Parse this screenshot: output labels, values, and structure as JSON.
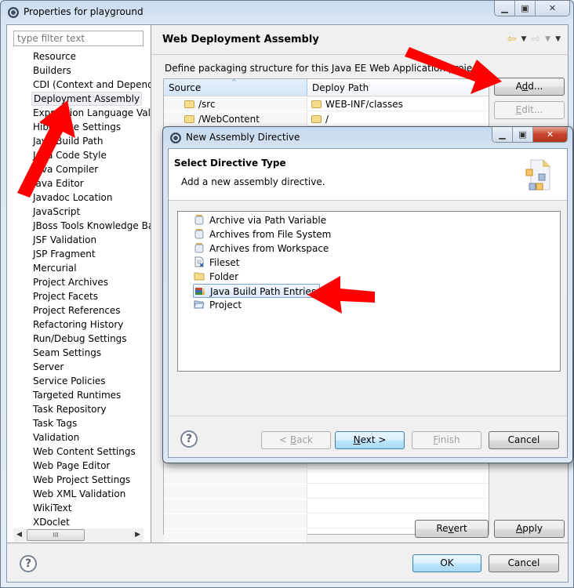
{
  "window": {
    "title": "Properties for playground",
    "icon": "gear-icon",
    "caption_buttons": [
      "minimize",
      "maximize",
      "close"
    ]
  },
  "filter": {
    "placeholder": "type filter text",
    "value": ""
  },
  "tree": {
    "selected": "Deployment Assembly",
    "items": [
      "Resource",
      "Builders",
      "CDI (Context and Dependen",
      "Deployment Assembly",
      "Expression Language Valida",
      "Hibernate Settings",
      "Java Build Path",
      "Java Code Style",
      "Java Compiler",
      "Java Editor",
      "Javadoc Location",
      "JavaScript",
      "JBoss Tools Knowledge Bas",
      "JSF Validation",
      "JSP Fragment",
      "Mercurial",
      "Project Archives",
      "Project Facets",
      "Project References",
      "Refactoring History",
      "Run/Debug Settings",
      "Seam Settings",
      "Server",
      "Service Policies",
      "Targeted Runtimes",
      "Task Repository",
      "Task Tags",
      "Validation",
      "Web Content Settings",
      "Web Page Editor",
      "Web Project Settings",
      "Web XML Validation",
      "WikiText",
      "XDoclet"
    ],
    "scrollbar_thumb": "III"
  },
  "page": {
    "title": "Web Deployment Assembly",
    "description": "Define packaging structure for this Java EE Web Application project.",
    "nav": {
      "back": "⇦",
      "forward": "⇨",
      "dropdown": "▼"
    },
    "table": {
      "columns": [
        "Source",
        "Deploy Path"
      ],
      "sort_indicator": "^",
      "rows": [
        {
          "source": "/src",
          "deploy_path": "WEB-INF/classes"
        },
        {
          "source": "/WebContent",
          "deploy_path": "/"
        }
      ]
    },
    "buttons": {
      "add": {
        "pre": "A",
        "mn": "d",
        "post": "d..."
      },
      "edit": {
        "pre": "",
        "mn": "E",
        "post": "dit..."
      },
      "revert": {
        "pre": "Re",
        "mn": "v",
        "post": "ert"
      },
      "apply": {
        "pre": "",
        "mn": "A",
        "post": "pply"
      }
    }
  },
  "footer": {
    "help": "?",
    "ok": "OK",
    "cancel": "Cancel"
  },
  "dialog": {
    "title": "New Assembly Directive",
    "banner_title": "Select Directive Type",
    "banner_description": "Add a new assembly directive.",
    "selected": "Java Build Path Entries",
    "items": [
      {
        "label": "Archive via Path Variable",
        "icon": "jar-icon"
      },
      {
        "label": "Archives from File System",
        "icon": "jar-icon"
      },
      {
        "label": "Archives from Workspace",
        "icon": "jar-icon"
      },
      {
        "label": "Fileset",
        "icon": "fileset-icon"
      },
      {
        "label": "Folder",
        "icon": "folder-icon"
      },
      {
        "label": "Java Build Path Entries",
        "icon": "library-icon"
      },
      {
        "label": "Project",
        "icon": "project-folder-icon"
      }
    ],
    "buttons": {
      "back": {
        "pre": "< ",
        "mn": "B",
        "post": "ack"
      },
      "next": {
        "pre": "",
        "mn": "N",
        "post": "ext >"
      },
      "finish": {
        "pre": "",
        "mn": "F",
        "post": "inish"
      },
      "cancel": "Cancel",
      "help": "?"
    }
  },
  "annotations": {
    "arrow_color": "#ff0000",
    "targets": [
      "Deployment Assembly",
      "Add...",
      "Java Build Path Entries"
    ]
  }
}
